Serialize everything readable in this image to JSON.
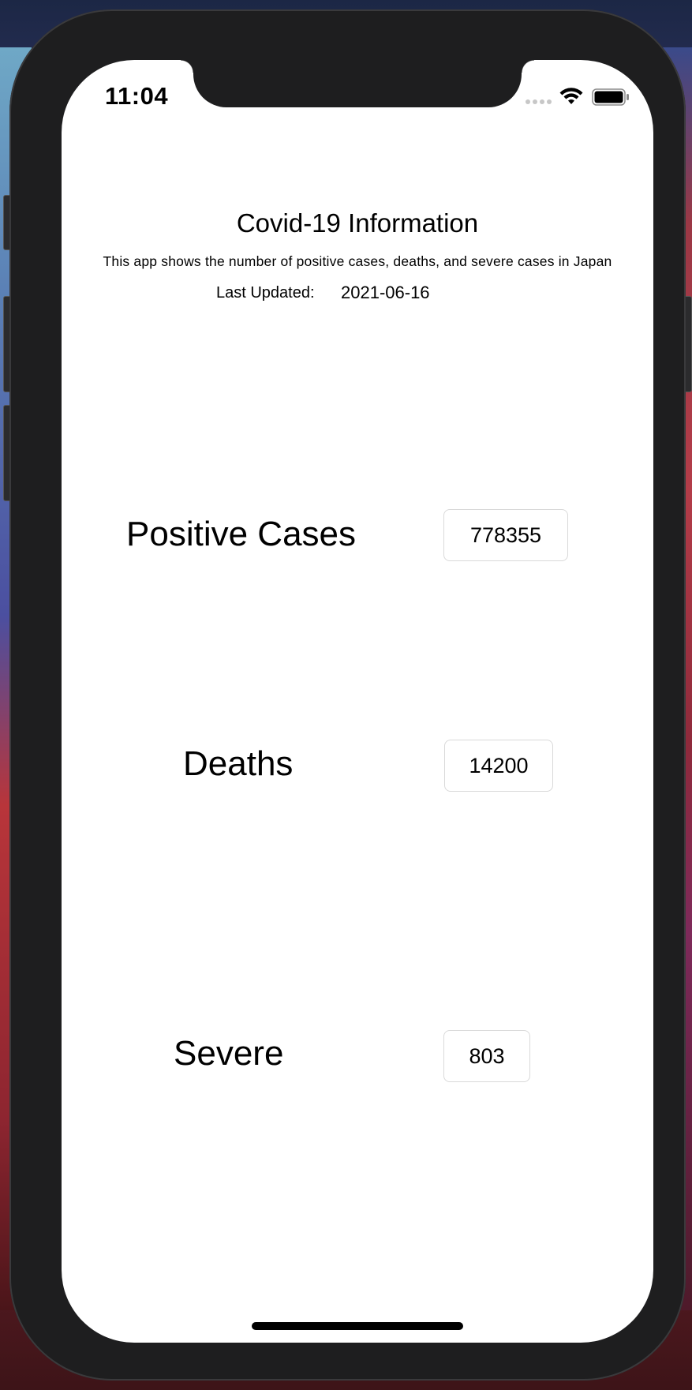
{
  "status_bar": {
    "time": "11:04"
  },
  "header": {
    "title": "Covid-19 Information",
    "subtitle": "This app shows the number of positive cases, deaths, and severe cases in Japan",
    "last_updated_label": "Last Updated:",
    "last_updated_value": "2021-06-16"
  },
  "stats": {
    "positive": {
      "label": "Positive Cases",
      "value": "778355"
    },
    "deaths": {
      "label": "Deaths",
      "value": "14200"
    },
    "severe": {
      "label": "Severe",
      "value": "803"
    }
  },
  "icons": {
    "wifi": "wifi-icon",
    "battery": "battery-icon",
    "signal": "signal-dots-icon"
  }
}
